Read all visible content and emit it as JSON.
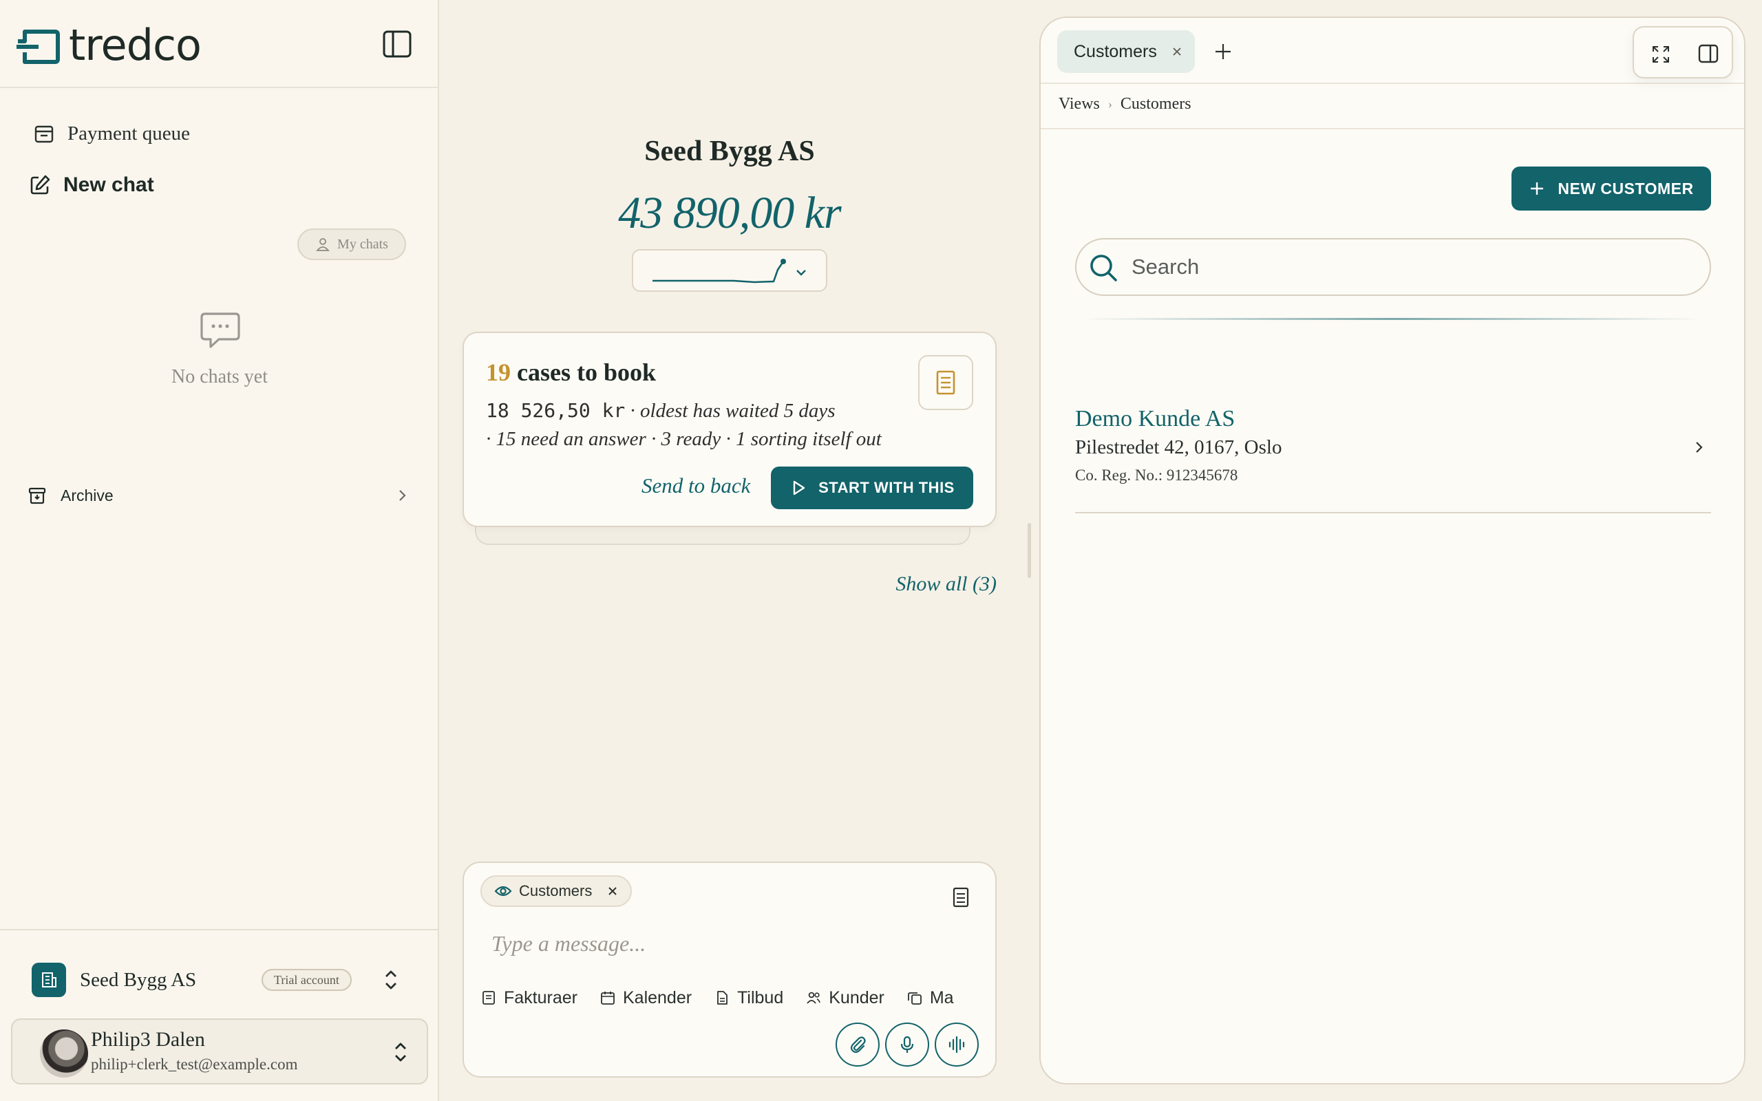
{
  "app": {
    "logo_text": "tredco"
  },
  "sidebar": {
    "payment_queue": "Payment queue",
    "new_chat": "New chat",
    "my_chats": "My chats",
    "empty_text": "No chats yet",
    "archive": "Archive",
    "org": {
      "name": "Seed Bygg AS",
      "badge": "Trial account"
    },
    "user": {
      "name": "Philip3 Dalen",
      "email": "philip+clerk_test@example.com"
    }
  },
  "center": {
    "company": "Seed Bygg AS",
    "amount": "43 890,00 kr",
    "case_card": {
      "count": "19",
      "title_rest": " cases to book",
      "amount": "18 526,50 kr",
      "meta1": " · oldest has waited 5 days",
      "meta2": "· 15 need an answer · 3 ready · 1 sorting itself out",
      "send_back": "Send to back",
      "start": "START WITH THIS"
    },
    "show_all": "Show all (3)"
  },
  "composer": {
    "context_chip": "Customers",
    "placeholder": "Type a message...",
    "shortcuts": [
      {
        "label": "Fakturaer",
        "icon": "invoice-icon"
      },
      {
        "label": "Kalender",
        "icon": "calendar-icon"
      },
      {
        "label": "Tilbud",
        "icon": "document-icon"
      },
      {
        "label": "Kunder",
        "icon": "users-icon"
      },
      {
        "label": "Ma",
        "icon": "copy-icon"
      }
    ]
  },
  "panel": {
    "tab": "Customers",
    "breadcrumb": [
      "Views",
      "Customers"
    ],
    "new_customer": "NEW CUSTOMER",
    "search_placeholder": "Search",
    "customers": [
      {
        "name": "Demo Kunde AS",
        "address": "Pilestredet 42, 0167, Oslo",
        "reg": "Co. Reg. No.: 912345678"
      }
    ]
  },
  "colors": {
    "accent": "#12636a",
    "highlight": "#c4932f",
    "background": "#f6f1e7"
  }
}
